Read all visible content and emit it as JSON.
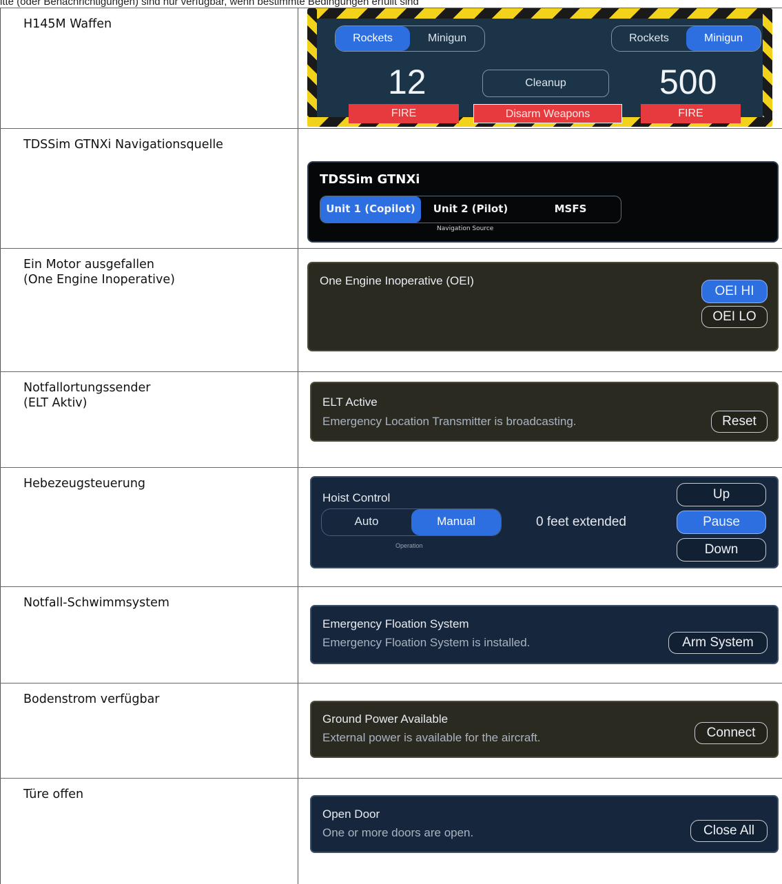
{
  "header_note": "itte (oder Benachrichtigungen) sind nur verfügbar, wenn bestimmte Bedingungen erfüllt sind",
  "rows": [
    {
      "label": [
        "H145M Waffen"
      ]
    },
    {
      "label": [
        "TDSSim GTNXi Navigationsquelle"
      ]
    },
    {
      "label": [
        "Ein Motor ausgefallen",
        "(One Engine Inoperative)"
      ]
    },
    {
      "label": [
        "Notfallortungssender",
        "(ELT Aktiv)"
      ]
    },
    {
      "label": [
        "Hebezeugsteuerung"
      ]
    },
    {
      "label": [
        "Notfall-Schwimmsystem"
      ]
    },
    {
      "label": [
        "Bodenstrom verfügbar"
      ]
    },
    {
      "label": [
        "Türe offen"
      ]
    }
  ],
  "weapons": {
    "left": {
      "seg": [
        "Rockets",
        "Minigun"
      ],
      "active": "Rockets",
      "count": "12",
      "fire": "FIRE"
    },
    "right": {
      "seg": [
        "Rockets",
        "Minigun"
      ],
      "active": "Minigun",
      "count": "500",
      "fire": "FIRE"
    },
    "cleanup": "Cleanup",
    "disarm": "Disarm Weapons"
  },
  "gtnxi": {
    "title": "TDSSim GTNXi",
    "options": [
      "Unit 1 (Copilot)",
      "Unit 2 (Pilot)",
      "MSFS"
    ],
    "active": "Unit 1 (Copilot)",
    "caption": "Navigation Source"
  },
  "oei": {
    "title": "One Engine Inoperative (OEI)",
    "buttons": [
      "OEI HI",
      "OEI LO"
    ],
    "active": "OEI HI"
  },
  "elt": {
    "title": "ELT Active",
    "text": "Emergency Location Transmitter is broadcasting.",
    "button": "Reset"
  },
  "hoist": {
    "title": "Hoist Control",
    "modes": [
      "Auto",
      "Manual"
    ],
    "active_mode": "Manual",
    "caption": "Operation",
    "status": "0 feet extended",
    "buttons": [
      "Up",
      "Pause",
      "Down"
    ],
    "active_button": "Pause"
  },
  "floats": {
    "title": "Emergency Floation System",
    "text": "Emergency Floation System is installed.",
    "button": "Arm System"
  },
  "ground_power": {
    "title": "Ground Power Available",
    "text": "External power is available for the aircraft.",
    "button": "Connect"
  },
  "door": {
    "title": "Open Door",
    "text": "One or more doors are open.",
    "button": "Close All"
  },
  "colors": {
    "accent_blue": "#2d6fe0",
    "fire_red": "#e63a3e",
    "hazard_yellow": "#f3d21c",
    "panel_navy": "#16263c"
  }
}
